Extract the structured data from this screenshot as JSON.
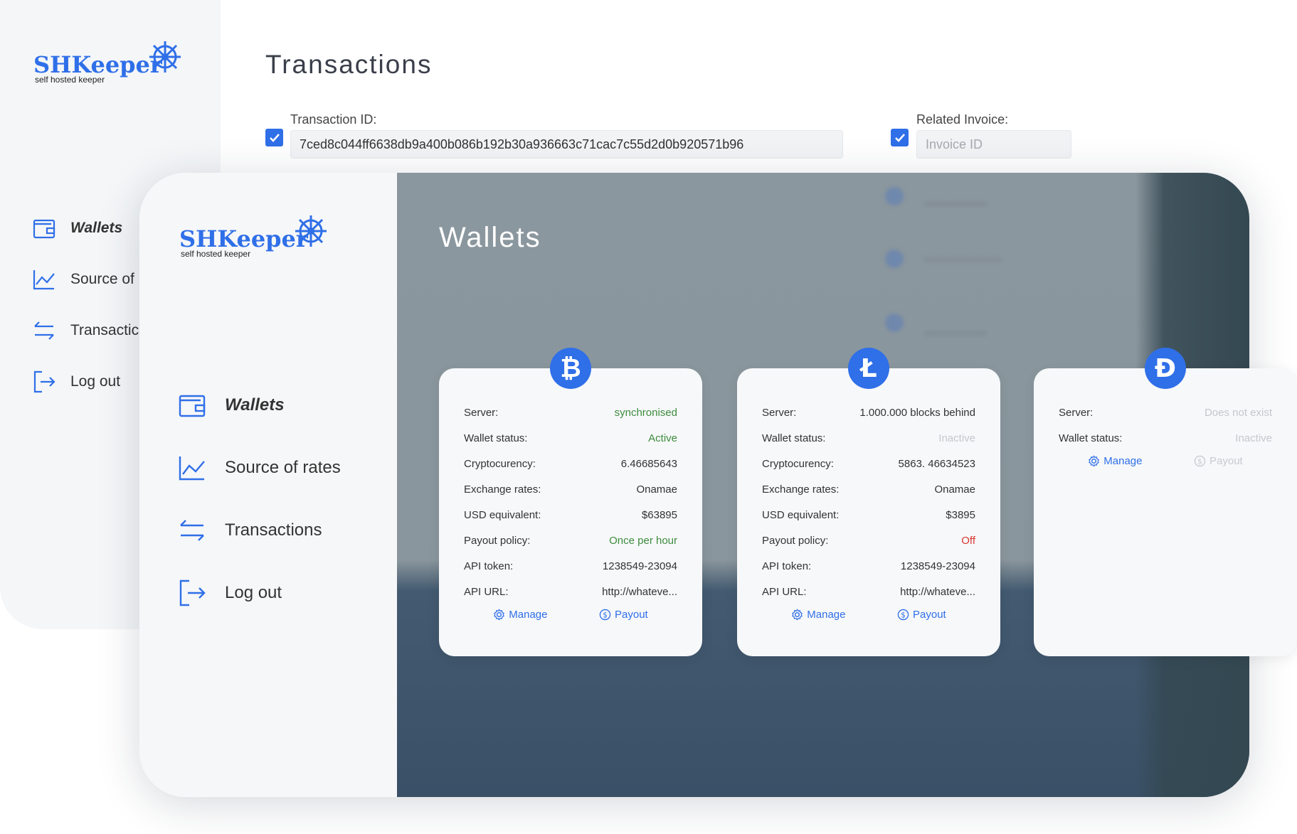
{
  "brand": {
    "name": "SHKeeper",
    "tagline": "self hosted keeper",
    "primary_color": "#2f6fe8"
  },
  "back_window": {
    "nav": [
      {
        "label": "Wallets",
        "icon": "wallet-icon",
        "active": true
      },
      {
        "label": "Source of",
        "icon": "chart-line-icon",
        "active": false
      },
      {
        "label": "Transactic",
        "icon": "arrows-swap-icon",
        "active": false
      },
      {
        "label": "Log out",
        "icon": "logout-icon",
        "active": false
      }
    ],
    "title": "Transactions",
    "filters": {
      "transaction_id": {
        "label": "Transaction ID:",
        "value": "7ced8c044ff6638db9a400b086b192b30a936663c71cac7c55d2d0b920571b96",
        "checked": true
      },
      "related_invoice": {
        "label": "Related Invoice:",
        "placeholder": "Invoice ID",
        "checked": true
      }
    }
  },
  "front_window": {
    "nav": [
      {
        "label": "Wallets",
        "icon": "wallet-icon",
        "active": true
      },
      {
        "label": "Source of rates",
        "icon": "chart-line-icon",
        "active": false
      },
      {
        "label": "Transactions",
        "icon": "arrows-swap-icon",
        "active": false
      },
      {
        "label": "Log out",
        "icon": "logout-icon",
        "active": false
      }
    ],
    "title": "Wallets",
    "wallets": [
      {
        "coin_symbol": "₿",
        "coin_icon": "bitcoin-icon",
        "rows": [
          {
            "key": "Server:",
            "value": "synchronised",
            "tone": "green"
          },
          {
            "key": "Wallet status:",
            "value": "Active",
            "tone": "green"
          },
          {
            "key": "Cryptocurency:",
            "value": "6.46685643",
            "tone": "normal"
          },
          {
            "key": "Exchange rates:",
            "value": "Onamae",
            "tone": "normal"
          },
          {
            "key": "USD equivalent:",
            "value": "$63895",
            "tone": "normal"
          },
          {
            "key": "Payout policy:",
            "value": "Once per hour",
            "tone": "green"
          },
          {
            "key": "API token:",
            "value": "1238549-23094",
            "tone": "normal"
          },
          {
            "key": "API URL:",
            "value": "http://whateve...",
            "tone": "normal"
          }
        ],
        "manage_label": "Manage",
        "payout_label": "Payout",
        "payout_enabled": true
      },
      {
        "coin_symbol": "Ł",
        "coin_icon": "litecoin-icon",
        "rows": [
          {
            "key": "Server:",
            "value": "1.000.000 blocks behind",
            "tone": "normal"
          },
          {
            "key": "Wallet status:",
            "value": "Inactive",
            "tone": "muted"
          },
          {
            "key": "Cryptocurency:",
            "value": "5863. 46634523",
            "tone": "normal"
          },
          {
            "key": "Exchange rates:",
            "value": "Onamae",
            "tone": "normal"
          },
          {
            "key": "USD equivalent:",
            "value": "$3895",
            "tone": "normal"
          },
          {
            "key": "Payout policy:",
            "value": "Off",
            "tone": "red"
          },
          {
            "key": "API token:",
            "value": "1238549-23094",
            "tone": "normal"
          },
          {
            "key": "API URL:",
            "value": "http://whateve...",
            "tone": "normal"
          }
        ],
        "manage_label": "Manage",
        "payout_label": "Payout",
        "payout_enabled": true
      },
      {
        "coin_symbol": "Đ",
        "coin_icon": "dogecoin-icon",
        "rows": [
          {
            "key": "Server:",
            "value": "Does not exist",
            "tone": "muted"
          },
          {
            "key": "Wallet status:",
            "value": "Inactive",
            "tone": "muted"
          }
        ],
        "manage_label": "Manage",
        "payout_label": "Payout",
        "payout_enabled": false
      }
    ]
  }
}
